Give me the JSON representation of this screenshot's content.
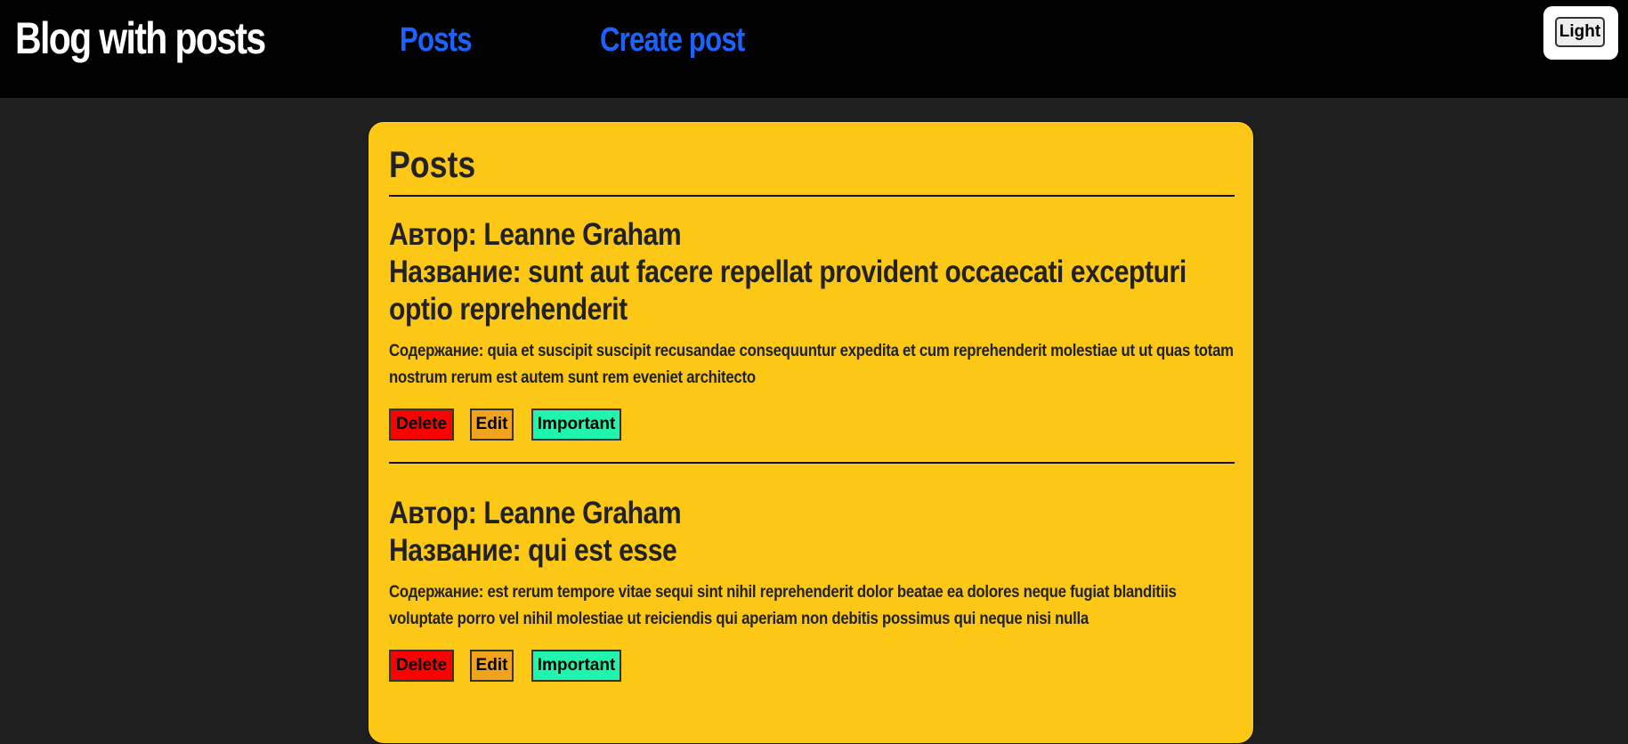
{
  "header": {
    "title": "Blog with posts",
    "nav": {
      "posts": "Posts",
      "create": "Create post"
    },
    "theme_toggle": "Light"
  },
  "colors": {
    "header_bg": "#000000",
    "page_bg": "#1f1f1f",
    "card_bg": "#fdc715",
    "link": "#1a63ff",
    "delete": "#ff0000",
    "edit": "#f0a31c",
    "important": "#1ff5ac"
  },
  "main": {
    "title": "Posts",
    "posts": [
      {
        "author": "Автор: Leanne Graham",
        "name": "Название: sunt aut facere repellat provident occaecati excepturi optio reprehenderit",
        "body": "Содержание: quia et suscipit suscipit recusandae consequuntur expedita et cum reprehenderit molestiae ut ut quas totam nostrum rerum est autem sunt rem eveniet architecto",
        "buttons": {
          "delete": "Delete",
          "edit": "Edit",
          "important": "Important"
        }
      },
      {
        "author": "Автор: Leanne Graham",
        "name": "Название: qui est esse",
        "body": "Содержание: est rerum tempore vitae sequi sint nihil reprehenderit dolor beatae ea dolores neque fugiat blanditiis voluptate porro vel nihil molestiae ut reiciendis qui aperiam non debitis possimus qui neque nisi nulla",
        "buttons": {
          "delete": "Delete",
          "edit": "Edit",
          "important": "Important"
        }
      }
    ]
  }
}
